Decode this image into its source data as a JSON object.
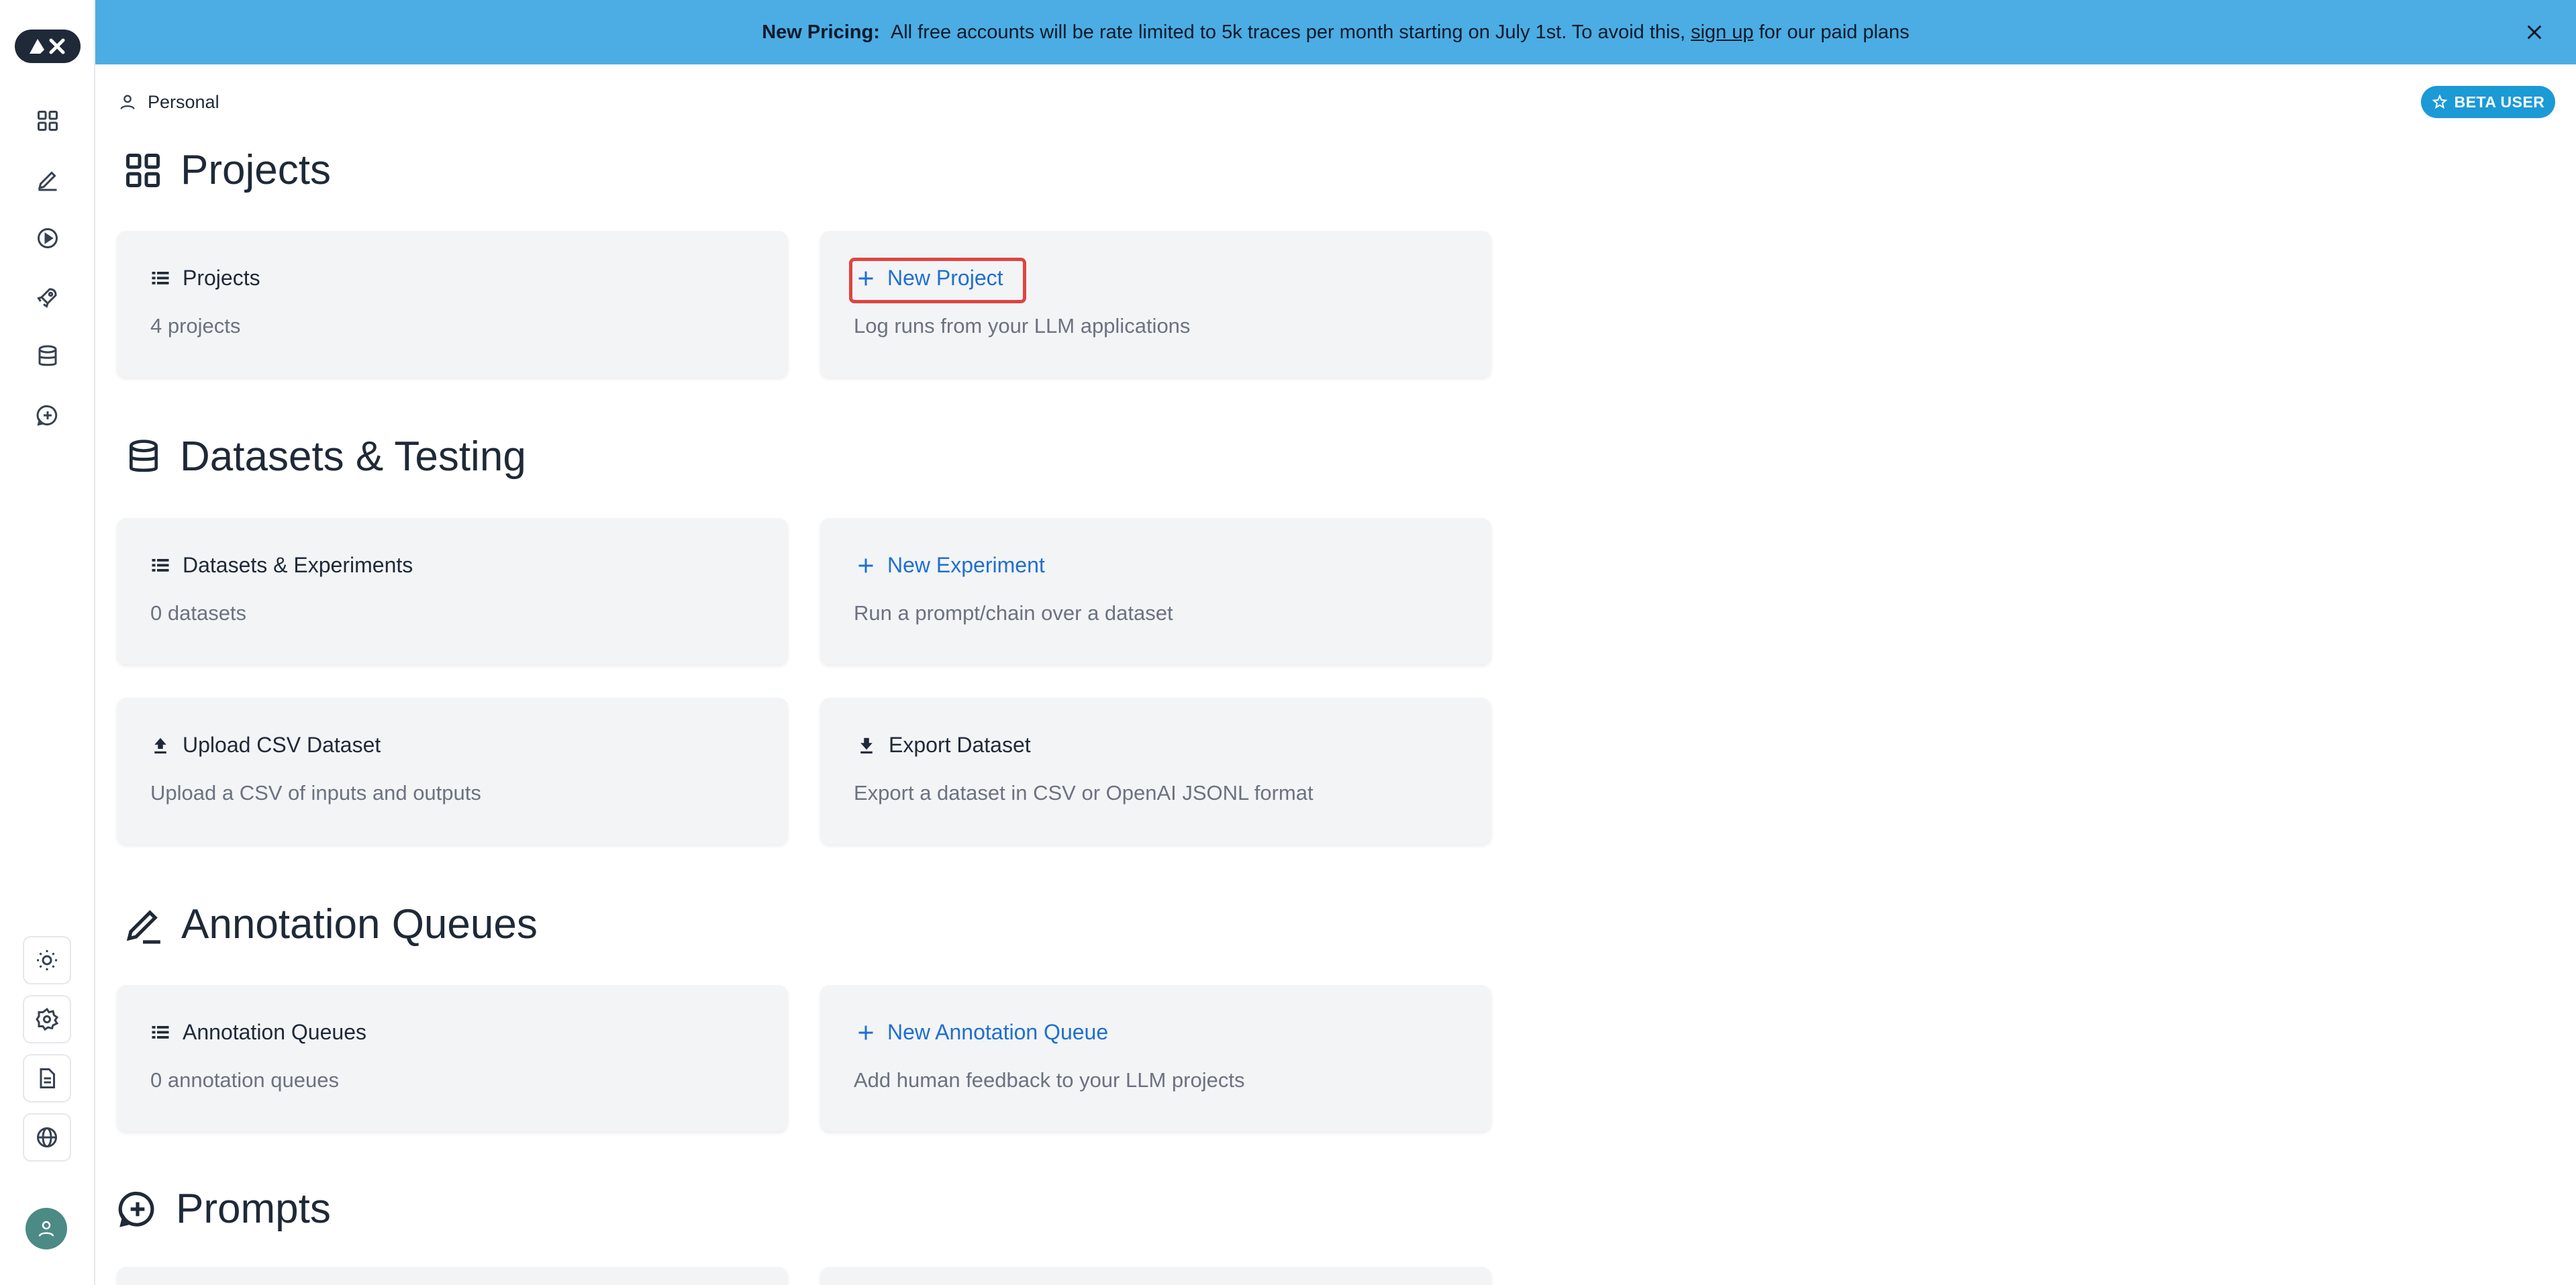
{
  "banner": {
    "bold": "New Pricing:",
    "text": "All free accounts will be rate limited to 5k traces per month starting on July 1st. To avoid this,",
    "link": "sign up",
    "text_after": "for our paid plans"
  },
  "header": {
    "workspace": "Personal",
    "badge": "BETA USER"
  },
  "sections": {
    "projects": {
      "title": "Projects",
      "list_card": {
        "title": "Projects",
        "subtitle": "4 projects"
      },
      "action_card": {
        "title": "New Project",
        "subtitle": "Log runs from your LLM applications"
      }
    },
    "datasets": {
      "title": "Datasets & Testing",
      "list_card": {
        "title": "Datasets & Experiments",
        "subtitle": "0 datasets"
      },
      "action_card": {
        "title": "New Experiment",
        "subtitle": "Run a prompt/chain over a dataset"
      },
      "upload_card": {
        "title": "Upload CSV Dataset",
        "subtitle": "Upload a CSV of inputs and outputs"
      },
      "export_card": {
        "title": "Export Dataset",
        "subtitle": "Export a dataset in CSV or OpenAI JSONL format"
      }
    },
    "annotation": {
      "title": "Annotation Queues",
      "list_card": {
        "title": "Annotation Queues",
        "subtitle": "0 annotation queues"
      },
      "action_card": {
        "title": "New Annotation Queue",
        "subtitle": "Add human feedback to your LLM projects"
      }
    },
    "prompts": {
      "title": "Prompts"
    }
  },
  "colors": {
    "banner_bg": "#4bade3",
    "link": "#1f6fcf",
    "badge": "#1b9ad6",
    "highlight": "#e0443f"
  }
}
